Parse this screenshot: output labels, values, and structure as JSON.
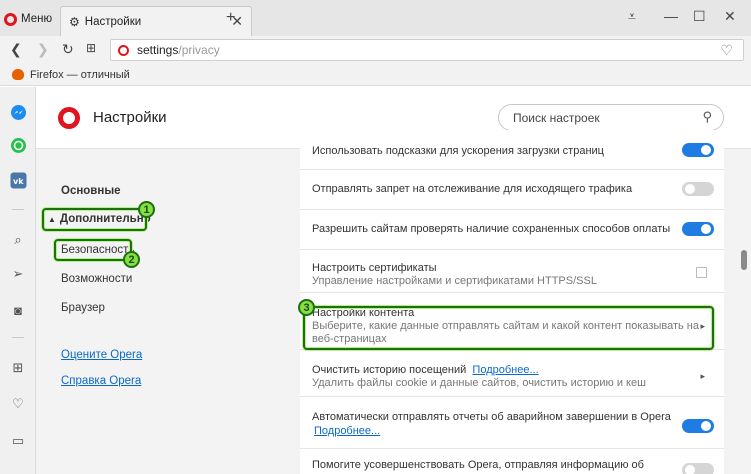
{
  "tabbar": {
    "menu_label": "Меню",
    "tab_title": "Настройки",
    "new_tab": "+",
    "controls": [
      "⩡",
      "—",
      "☐",
      "✕"
    ]
  },
  "address": {
    "url_main": "settings",
    "url_rest": "/privacy"
  },
  "bookmarks": {
    "item": "Firefox — отличный"
  },
  "sidebar_icons": [
    "messenger-icon",
    "whatsapp-icon",
    "vk-icon",
    "search-icon",
    "send-icon",
    "camera-icon",
    "grid-icon",
    "heart-icon",
    "sidebar-icon"
  ],
  "settings": {
    "title": "Настройки",
    "search_placeholder": "Поиск настроек"
  },
  "nav": {
    "basic": "Основные",
    "advanced": "Дополнительно",
    "security": "Безопасность",
    "features": "Возможности",
    "browser": "Браузер",
    "rate": "Оцените Opera",
    "help": "Справка Opera"
  },
  "rows": [
    {
      "label": "Использовать подсказки для ускорения загрузки страниц",
      "toggle": "on"
    },
    {
      "label": "Отправлять запрет на отслеживание для исходящего трафика",
      "toggle": "off"
    },
    {
      "label": "Разрешить сайтам проверять наличие сохраненных способов оплаты",
      "toggle": "on"
    },
    {
      "label": "Настроить сертификаты",
      "sub": "Управление настройками и сертификатами HTTPS/SSL"
    },
    {
      "label": "Настройки контента",
      "sub1": "Выберите, какие данные отправлять сайтам и какой контент показывать на",
      "sub2": "веб-страницах"
    },
    {
      "label": "Очистить историю посещений",
      "link": "Подробнее...",
      "sub": "Удалить файлы cookie и данные сайтов, очистить историю и кеш"
    },
    {
      "label": "Автоматически отправлять отчеты об аварийном завершении в Opera",
      "link": "Подробнее...",
      "toggle": "on"
    },
    {
      "label": "Помогите усовершенствовать Opera, отправляя информацию об",
      "toggle": "off"
    }
  ],
  "annotations": [
    "1",
    "2",
    "3"
  ],
  "colors": {
    "accent": "#1f7ce0",
    "opera_red": "#e0141e",
    "annotation_green": "#86df45"
  }
}
